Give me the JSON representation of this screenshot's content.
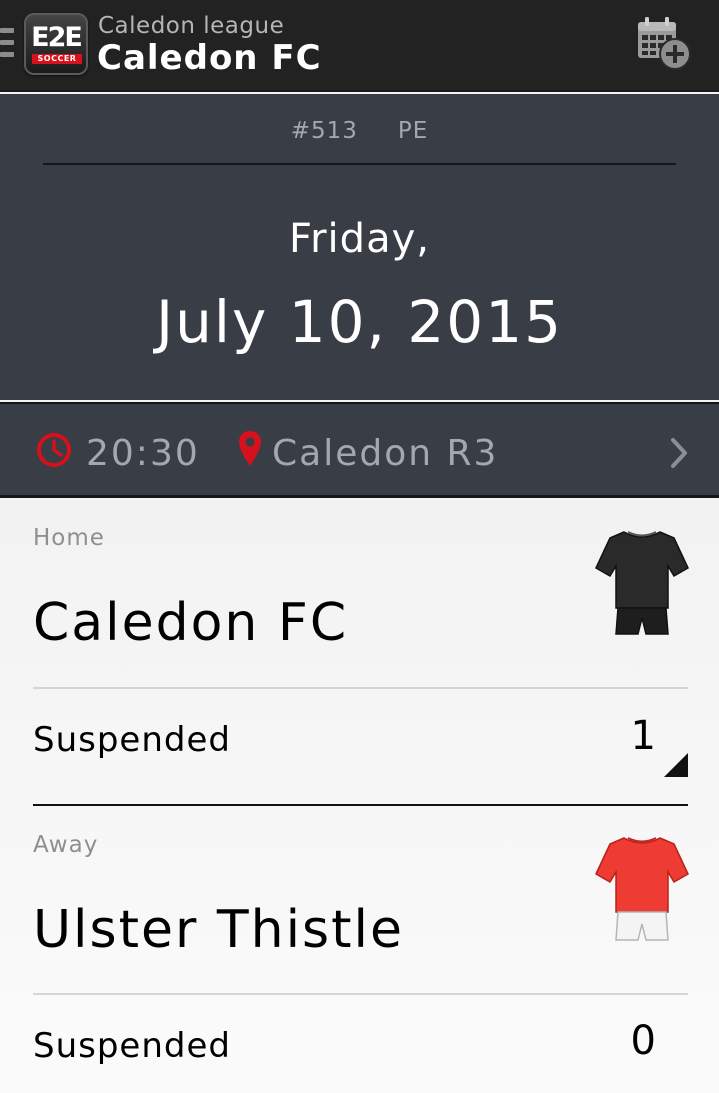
{
  "header": {
    "league": "Caledon league",
    "team": "Caledon FC",
    "logo_top": "E2E",
    "logo_bottom": "SOCCER"
  },
  "match": {
    "number": "#513",
    "code": "PE",
    "weekday": "Friday,",
    "date": "July 10, 2015",
    "time": "20:30",
    "venue": "Caledon R3"
  },
  "home": {
    "label": "Home",
    "name": "Caledon FC",
    "suspended_label": "Suspended",
    "suspended_value": "1",
    "kit_color": "#2a2a2a"
  },
  "away": {
    "label": "Away",
    "name": "Ulster Thistle",
    "suspended_label": "Suspended",
    "suspended_value": "0",
    "kit_color": "#ee3b33"
  },
  "colors": {
    "accent": "#d6101c",
    "header_bg": "#222222",
    "panel_bg": "#393d45"
  }
}
